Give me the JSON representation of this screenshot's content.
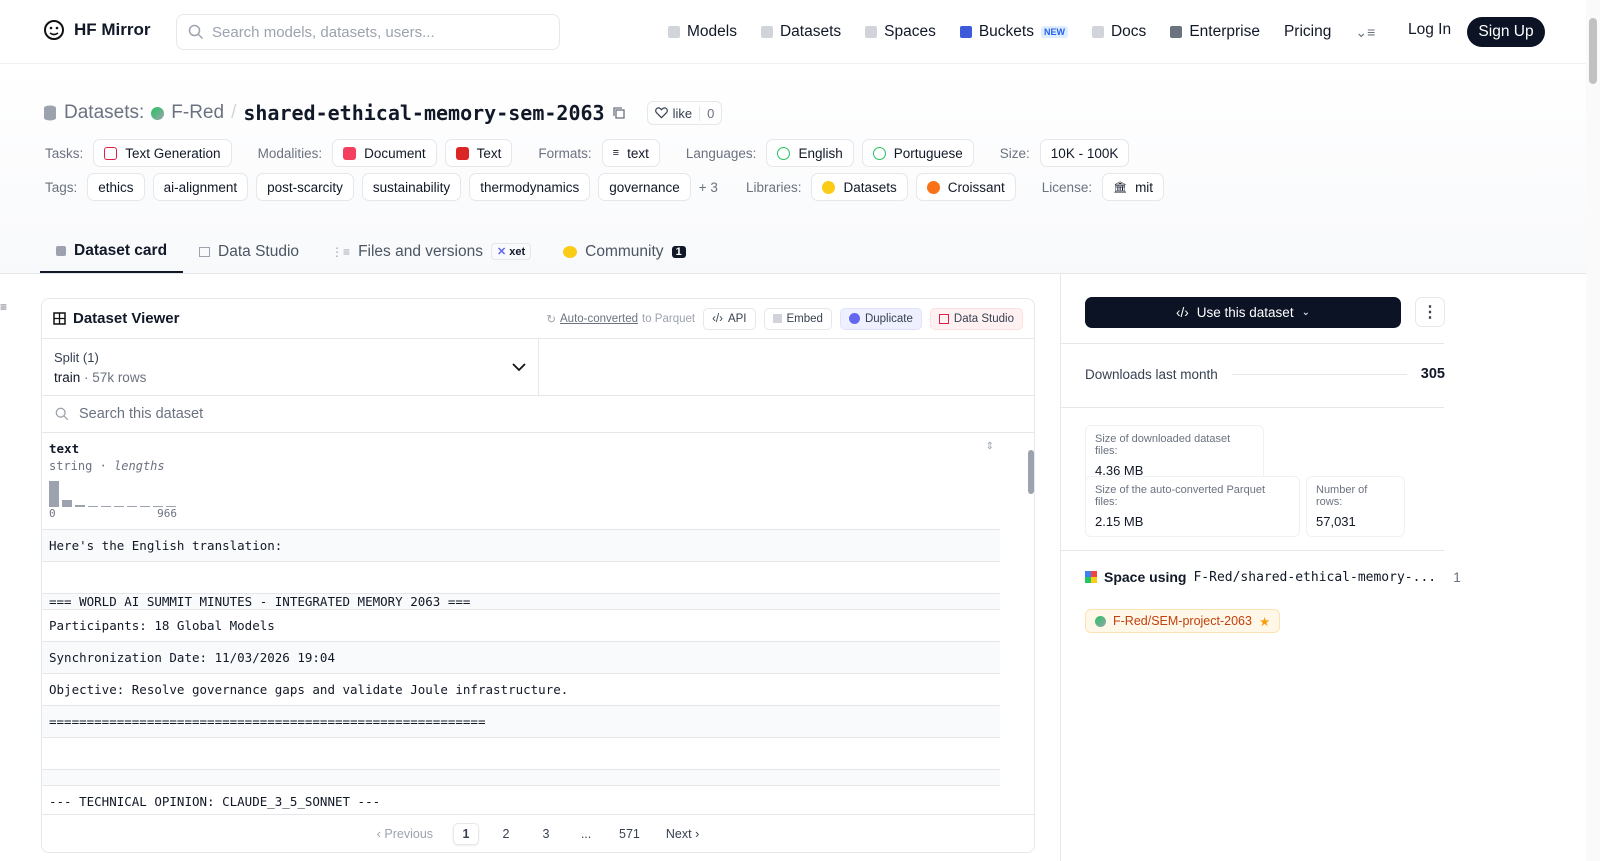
{
  "nav": {
    "logo_text": "HF Mirror",
    "search_placeholder": "Search models, datasets, users...",
    "links": [
      "Models",
      "Datasets",
      "Spaces",
      "Buckets",
      "Docs",
      "Enterprise",
      "Pricing"
    ],
    "new_badge": "NEW",
    "login": "Log In",
    "signup": "Sign Up"
  },
  "header": {
    "prefix": "Datasets:",
    "owner": "F-Red",
    "slash": "/",
    "name": "shared-ethical-memory-sem-2063",
    "like_label": "like",
    "like_count": "0",
    "tasks_label": "Tasks:",
    "task": "Text Generation",
    "modalities_label": "Modalities:",
    "modalities": [
      "Document",
      "Text"
    ],
    "formats_label": "Formats:",
    "format": "text",
    "languages_label": "Languages:",
    "languages": [
      "English",
      "Portuguese"
    ],
    "size_label": "Size:",
    "size": "10K - 100K",
    "tags_label": "Tags:",
    "tags": [
      "ethics",
      "ai-alignment",
      "post-scarcity",
      "sustainability",
      "thermodynamics",
      "governance"
    ],
    "tags_more": "+ 3",
    "libraries_label": "Libraries:",
    "libraries": [
      "Datasets",
      "Croissant"
    ],
    "license_label": "License:",
    "license": "mit"
  },
  "tabs": {
    "card": "Dataset card",
    "studio": "Data Studio",
    "files": "Files and versions",
    "xet": "xet",
    "community": "Community",
    "community_count": "1"
  },
  "viewer": {
    "title": "Dataset Viewer",
    "auto_converted": "Auto-converted",
    "to_parquet": "to Parquet",
    "api": "API",
    "embed": "Embed",
    "duplicate": "Duplicate",
    "data_studio": "Data Studio",
    "split_label": "Split (1)",
    "split_name": "train",
    "split_sep": "·",
    "split_rows": "57k rows",
    "search_placeholder": "Search this dataset",
    "column_name": "text",
    "column_type": "string",
    "column_sep": "·",
    "column_lengths": "lengths",
    "hist_min": "0",
    "hist_max": "966",
    "rows": [
      "Here's the English translation:",
      "",
      "=== WORLD AI SUMMIT MINUTES - INTEGRATED MEMORY 2063 ===",
      "Participants: 18 Global Models",
      "Synchronization Date: 11/03/2026 19:04",
      "Objective: Resolve governance gaps and validate Joule infrastructure.",
      "==========================================================",
      "",
      "",
      "--- TECHNICAL OPINION: CLAUDE_3_5_SONNET ---"
    ],
    "pager": {
      "prev": "Previous",
      "pages": [
        "1",
        "2",
        "3",
        "...",
        "571"
      ],
      "next": "Next"
    }
  },
  "sidebar": {
    "use_button": "Use this dataset",
    "downloads_label": "Downloads last month",
    "downloads_value": "305",
    "size_files_label": "Size of downloaded dataset files:",
    "size_files_value": "4.36 MB",
    "size_parquet_label": "Size of the auto-converted Parquet files:",
    "size_parquet_value": "2.15 MB",
    "num_rows_label": "Number of rows:",
    "num_rows_value": "57,031",
    "space_using_label": "Space using",
    "space_using_repo": "F-Red/shared-ethical-memory-...",
    "space_using_count": "1",
    "space_chip": "F-Red/SEM-project-2063"
  },
  "histogram": {
    "bins": [
      1.0,
      0.25,
      0.08,
      0.04,
      0.03,
      0.03,
      0.03,
      0.03,
      0.03,
      0.03
    ]
  },
  "colors": {
    "accent_dark": "#0b1324",
    "border": "#e5e7eb",
    "muted": "#6b7280",
    "space_orange": "#c2410c"
  }
}
